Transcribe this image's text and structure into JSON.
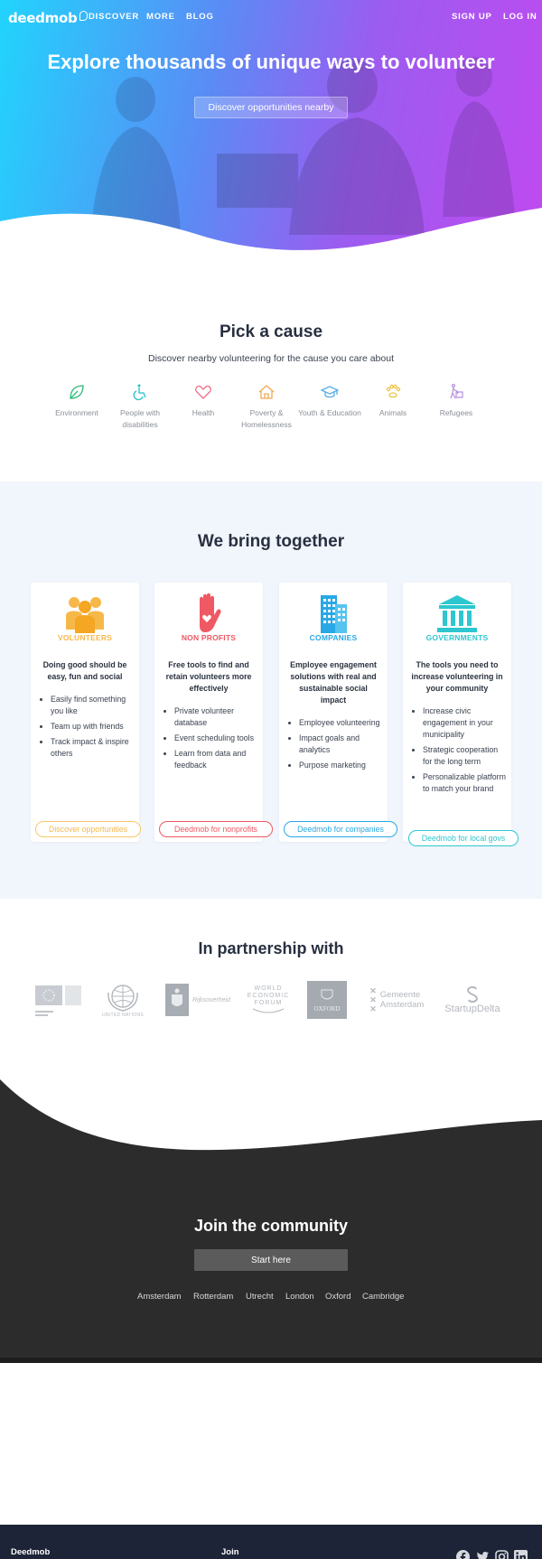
{
  "nav": {
    "logo": "deedmob",
    "links": [
      "DISCOVER",
      "MORE",
      "BLOG"
    ],
    "sign_up": "SIGN UP",
    "log_in": "LOG IN"
  },
  "hero": {
    "title": "Explore thousands of unique ways to volunteer",
    "button": "Discover opportunities nearby"
  },
  "pick": {
    "title": "Pick a cause",
    "subtitle": "Discover nearby volunteering for the cause you care about",
    "causes": [
      {
        "label": "Environment",
        "icon": "leaf-icon",
        "color": "#2db87b"
      },
      {
        "label": "People with disabilities",
        "icon": "wheelchair-icon",
        "color": "#25c0c9"
      },
      {
        "label": "Health",
        "icon": "heart-icon",
        "color": "#f06c86"
      },
      {
        "label": "Poverty & Homelessness",
        "icon": "house-icon",
        "color": "#f5a855"
      },
      {
        "label": "Youth & Education",
        "icon": "graduation-cap-icon",
        "color": "#5aaee8"
      },
      {
        "label": "Animals",
        "icon": "paw-icon",
        "color": "#f0c040"
      },
      {
        "label": "Refugees",
        "icon": "refugee-icon",
        "color": "#b48fe0"
      }
    ]
  },
  "together": {
    "title": "We bring together",
    "cards": [
      {
        "heading": "VOLUNTEERS",
        "color": "#f7b84a",
        "lead": "Doing good should be easy, fun and social",
        "items": [
          "Easily find something you like",
          "Team up with friends",
          "Track impact & inspire others"
        ],
        "button": "Discover opportunities"
      },
      {
        "heading": "NON PROFITS",
        "color": "#ef5963",
        "lead": "Free tools to find and retain volunteers more effectively",
        "items": [
          "Private volunteer database",
          "Event scheduling tools",
          "Learn from data and feedback"
        ],
        "button": "Deedmob for nonprofits"
      },
      {
        "heading": "COMPANIES",
        "color": "#29a8e6",
        "lead": "Employee engagement solutions with real and sustainable social impact",
        "items": [
          "Employee volunteering",
          "Impact goals and analytics",
          "Purpose marketing"
        ],
        "button": "Deedmob for companies"
      },
      {
        "heading": "GOVERNMENTS",
        "color": "#2ec7cf",
        "lead": "The tools you need to increase volunteering in your community",
        "items": [
          "Increase civic engagement in your municipality",
          "Strategic cooperation for the long term",
          "Personalizable platform to match your brand"
        ],
        "button": "Deedmob for local govs"
      }
    ]
  },
  "partners": {
    "title": "In partnership with",
    "logos": [
      {
        "name": "european-commission-logo",
        "text": "European Commission"
      },
      {
        "name": "united-nations-logo",
        "text": "UNITED NATIONS"
      },
      {
        "name": "rijksoverheid-logo",
        "text": "Rijksoverheid"
      },
      {
        "name": "world-economic-forum-logo",
        "text": "WORLD ECONOMIC FORUM"
      },
      {
        "name": "oxford-logo",
        "text": "OXFORD"
      },
      {
        "name": "gemeente-amsterdam-logo",
        "text": "Gemeente Amsterdam"
      },
      {
        "name": "startupdelta-logo",
        "text": "StartupDelta"
      }
    ]
  },
  "community": {
    "title": "Join the community",
    "button": "Start here",
    "cities": [
      "Amsterdam",
      "Rotterdam",
      "Utrecht",
      "London",
      "Oxford",
      "Cambridge"
    ]
  },
  "footer": {
    "col1": "Deedmob",
    "col2": "Join",
    "social": [
      "facebook-icon",
      "twitter-icon",
      "instagram-icon",
      "linkedin-icon"
    ]
  }
}
